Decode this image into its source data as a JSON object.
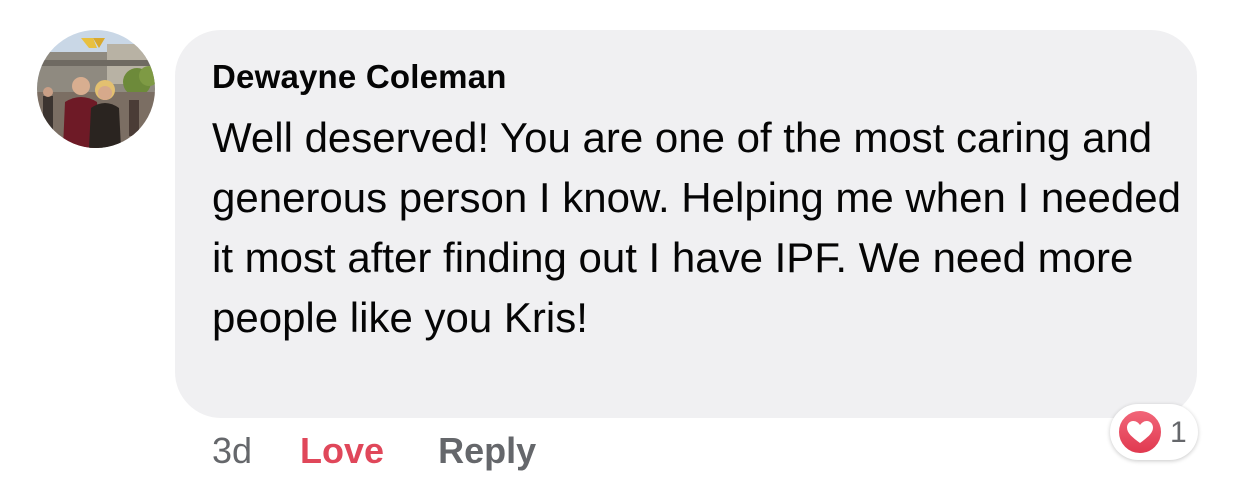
{
  "comment": {
    "author": "Dewayne Coleman",
    "text": "Well deserved! You are one of the most caring and generous person I know. Helping me when I needed it most after finding out I have IPF. We need more people like you Kris!",
    "avatar_icon": "profile-photo-couple-at-stadium"
  },
  "actions": {
    "time": "3d",
    "love_label": "Love",
    "reply_label": "Reply"
  },
  "reactions": {
    "icon": "love-heart-icon",
    "count": "1",
    "color": "#e0475a"
  },
  "colors": {
    "bubble": "#f0f0f2",
    "text": "#050505",
    "secondary": "#65676b",
    "love": "#e0475a"
  }
}
